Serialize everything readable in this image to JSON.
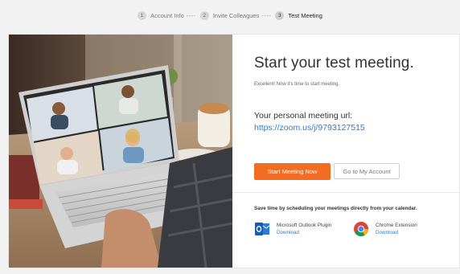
{
  "stepper": {
    "steps": [
      {
        "num": "1",
        "label": "Account Info"
      },
      {
        "num": "2",
        "label": "Invite Colleagues"
      },
      {
        "num": "3",
        "label": "Test Meeting"
      }
    ],
    "separator": "----"
  },
  "main": {
    "title": "Start your test meeting.",
    "subtitle": "Excellent! Now it's time to start meeting.",
    "url_label": "Your personal meeting url:",
    "url": "https://zoom.us/j/9793127515",
    "start_button": "Start Meeting Now",
    "account_button": "Go to My Account",
    "schedule_text": "Save time by scheduling your meetings directly from your calendar.",
    "extensions": [
      {
        "name": "Microsoft Outlook Plugin",
        "link": "Download",
        "icon": "outlook-icon"
      },
      {
        "name": "Chrome Extension",
        "link": "Download",
        "icon": "chrome-icon"
      }
    ]
  },
  "colors": {
    "accent": "#f26d21",
    "link": "#2b7bd6"
  }
}
